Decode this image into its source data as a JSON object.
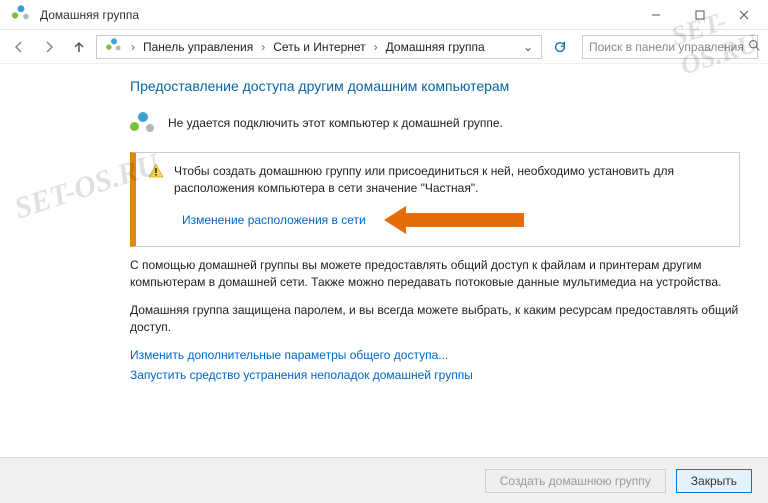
{
  "window": {
    "title": "Домашняя группа"
  },
  "toolbar": {
    "breadcrumb": {
      "item1": "Панель управления",
      "item2": "Сеть и Интернет",
      "item3": "Домашняя группа"
    },
    "search_placeholder": "Поиск в панели управления"
  },
  "page": {
    "heading": "Предоставление доступа другим домашним компьютерам",
    "status": "Не удается подключить этот компьютер к домашней группе.",
    "warnbox": {
      "message": "Чтобы создать домашнюю группу или присоединиться к ней, необходимо установить для расположения компьютера в сети значение \"Частная\".",
      "link": "Изменение расположения в сети"
    },
    "para1": "С помощью домашней группы вы можете предоставлять общий доступ к файлам и принтерам другим компьютерам в домашней сети. Также можно передавать потоковые данные мультимедиа на устройства.",
    "para2": "Домашняя группа защищена паролем, и вы всегда можете выбрать, к каким ресурсам предоставлять общий доступ.",
    "link1": "Изменить дополнительные параметры общего доступа...",
    "link2": "Запустить средство устранения неполадок домашней группы"
  },
  "footer": {
    "create": "Создать домашнюю группу",
    "close": "Закрыть"
  },
  "watermark": "SET-OS.RU"
}
